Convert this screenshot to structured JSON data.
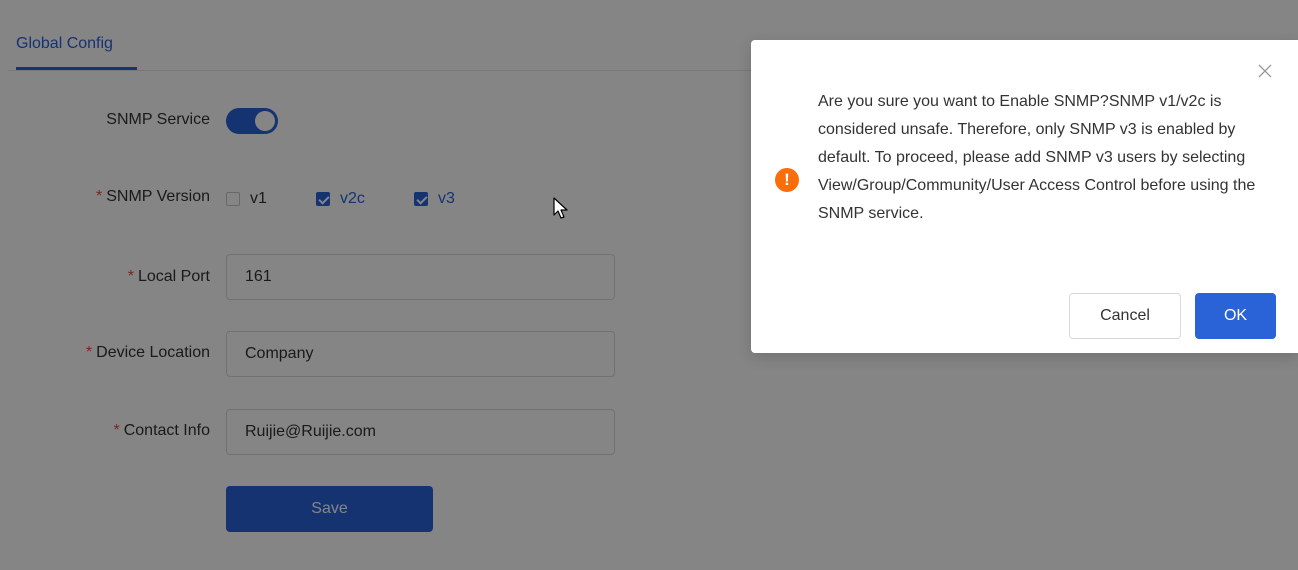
{
  "tabs": {
    "active": "Global Config"
  },
  "form": {
    "snmp_service_label": "SNMP Service",
    "snmp_service_enabled": true,
    "snmp_version_label": "SNMP Version",
    "versions": [
      {
        "label": "v1",
        "checked": false
      },
      {
        "label": "v2c",
        "checked": true
      },
      {
        "label": "v3",
        "checked": true
      }
    ],
    "local_port_label": "Local Port",
    "local_port_value": "161",
    "device_location_label": "Device Location",
    "device_location_value": "Company",
    "contact_info_label": "Contact Info",
    "contact_info_value": "Ruijie@Ruijie.com",
    "required_mark": "*",
    "save_label": "Save"
  },
  "dialog": {
    "message": "Are you sure you want to Enable SNMP?SNMP v1/v2c is considered unsafe. Therefore, only SNMP v3 is enabled by default. To proceed, please add SNMP v3 users by selecting View/Group/Community/User Access Control before using the SNMP service.",
    "warning_icon_glyph": "!",
    "close_icon": "close-icon",
    "cancel_label": "Cancel",
    "ok_label": "OK"
  },
  "colors": {
    "accent": "#2a62d8",
    "required": "#e84a4a",
    "warning": "#fa6e0a"
  }
}
